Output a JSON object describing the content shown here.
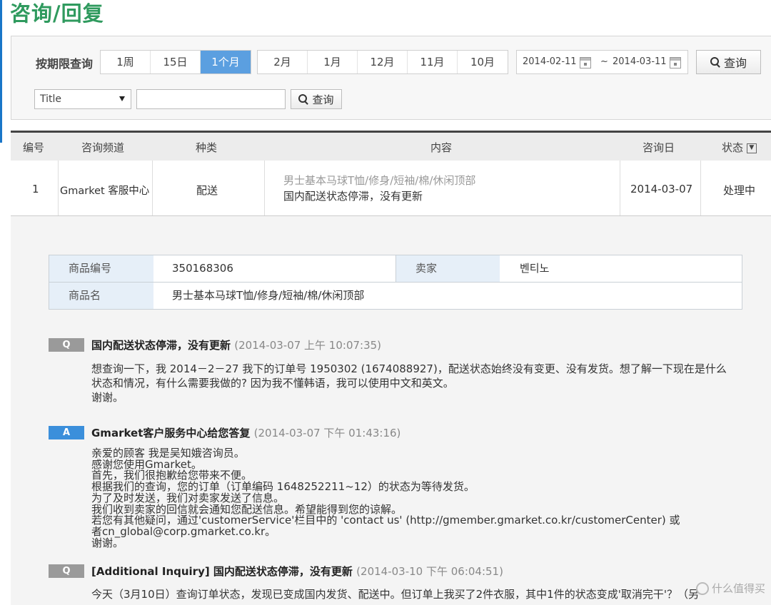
{
  "page_title": "咨询/回复",
  "filter": {
    "period_label": "按期限查询",
    "period_buttons": [
      "1周",
      "15日",
      "1个月"
    ],
    "active_period": "1个月",
    "month_buttons": [
      "2月",
      "1月",
      "12月",
      "11月",
      "10月"
    ],
    "date_from": "2014-02-11",
    "date_sep": "~",
    "date_to": "2014-03-11",
    "search_label": "查询",
    "field_select": "Title",
    "text_value": "",
    "search2_label": "查询"
  },
  "table": {
    "headers": [
      "编号",
      "咨询频道",
      "种类",
      "内容",
      "咨询日",
      "状态"
    ],
    "row": {
      "no": "1",
      "channel": "Gmarket 客服中心",
      "kind": "配送",
      "product": "男士基本马球T恤/修身/短袖/棉/休闲顶部",
      "subject": "国内配送状态停滞，没有更新",
      "date": "2014-03-07",
      "status": "处理中"
    }
  },
  "info": {
    "product_no_label": "商品编号",
    "product_no": "350168306",
    "seller_label": "卖家",
    "seller": "벤티노",
    "product_name_label": "商品名",
    "product_name": "男士基本马球T恤/修身/短袖/棉/休闲顶部"
  },
  "messages": [
    {
      "badge": "Q",
      "title": "国内配送状态停滞，没有更新",
      "time": "(2014-03-07 上午 10:07:35)",
      "body": "想查询一下，我 2014－2－27 我下的订单号 1950302 (1674088927)，配送状态始终没有变更、没有发货。想了解一下现在是什么\n状态和情况，有什么需要我做的? 因为我不懂韩语，我可以使用中文和英文。\n谢谢。"
    },
    {
      "badge": "A",
      "title": "Gmarket客户服务中心给您答复",
      "time": "(2014-03-07 下午 01:43:16)",
      "body": "亲爱的顾客 我是吴知娥咨询员。\n感谢您使用Gmarket。\n首先，我们很抱歉给您带来不便。\n根据我们的查询，您的订单（订单编码 1648252211~12）的状态为等待发货。\n为了及时发送，我们对卖家发送了信息。\n我们收到卖家的回信就会通知您配送信息。希望能得到您的谅解。\n 若您有其他疑问，通过'customerService'栏目中的 'contact us' (http://gmember.gmarket.co.kr/customerCenter) 或\n者cn_global@corp.gmarket.co.kr。\n谢谢。"
    },
    {
      "badge": "Q",
      "title": "[Additional Inquiry] 国内配送状态停滞，没有更新",
      "time": "(2014-03-10 下午 06:04:51)",
      "body": "今天（3月10日）查询订单状态，发现已变成国内发货、配送中。但订单上我买了2件衣服，其中1件的状态变成'取消完干'？（另"
    }
  ],
  "watermark": "什么值得买"
}
